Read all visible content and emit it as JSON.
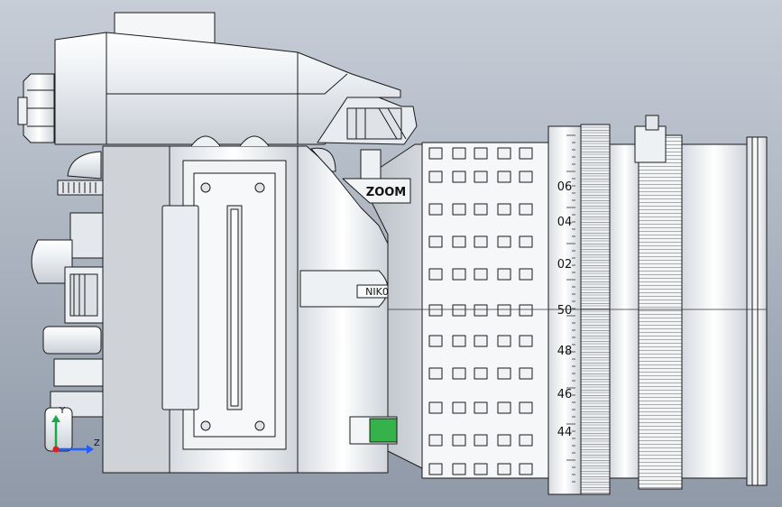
{
  "viewport": {
    "background_top": "#c5ccd6",
    "background_bottom": "#8e98a6"
  },
  "model": {
    "stroke": "#1a1a1a",
    "fill_light": "#f4f6f8",
    "fill_mid": "#dfe3e8",
    "fill_shade": "#b9bfc6",
    "accent_green": "#35b34a"
  },
  "labels": {
    "brand": "NIK0",
    "zoom_ring": "ZOOM",
    "scale": [
      "06",
      "04",
      "02",
      "50",
      "48",
      "46",
      "44"
    ]
  },
  "triad": {
    "x_label": "Z",
    "y_label": "Y",
    "x_color": "#1f5fff",
    "y_color": "#1aa84a",
    "origin_color": "#e02020"
  }
}
